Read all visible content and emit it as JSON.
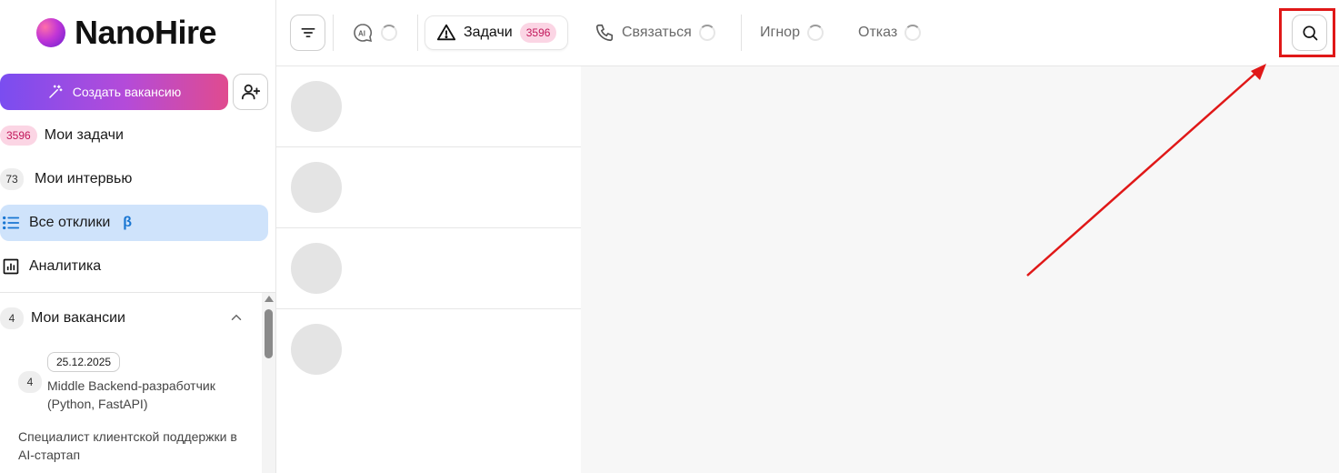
{
  "app": {
    "brand": "NanoHire"
  },
  "sidebar": {
    "create_label": "Создать вакансию",
    "nav": [
      {
        "label": "Мои задачи",
        "badge": "3596"
      },
      {
        "label": "Мои интервью",
        "badge": "73"
      },
      {
        "label": "Все отклики",
        "suffix": "β"
      },
      {
        "label": "Аналитика"
      }
    ],
    "vacancies": {
      "label": "Мои вакансии",
      "count": "4",
      "items": [
        {
          "date": "25.12.2025",
          "count": "4",
          "title": "Middle Backend-разработчик (Python, FastAPI)"
        },
        {
          "title": "Специалист клиентской поддержки в AI-стартап"
        }
      ]
    }
  },
  "topbar": {
    "tabs": [
      {
        "label": "Задачи",
        "badge": "3596"
      },
      {
        "label": "Связаться"
      },
      {
        "label": "Игнор"
      },
      {
        "label": "Отказ"
      }
    ],
    "ai_label": "AI"
  },
  "colors": {
    "accent_gradient_start": "#7a4df0",
    "accent_gradient_end": "#e04b8f",
    "active_nav_bg": "#cfe3fb",
    "badge_pink_bg": "#fbd5e4",
    "annotation_red": "#e01818"
  },
  "icons": [
    "filter-icon",
    "ai-chat-icon",
    "warning-icon",
    "phone-icon",
    "search-icon",
    "magic-wand-icon",
    "add-user-icon",
    "list-icon",
    "bar-chart-icon",
    "chevron-up-icon"
  ]
}
